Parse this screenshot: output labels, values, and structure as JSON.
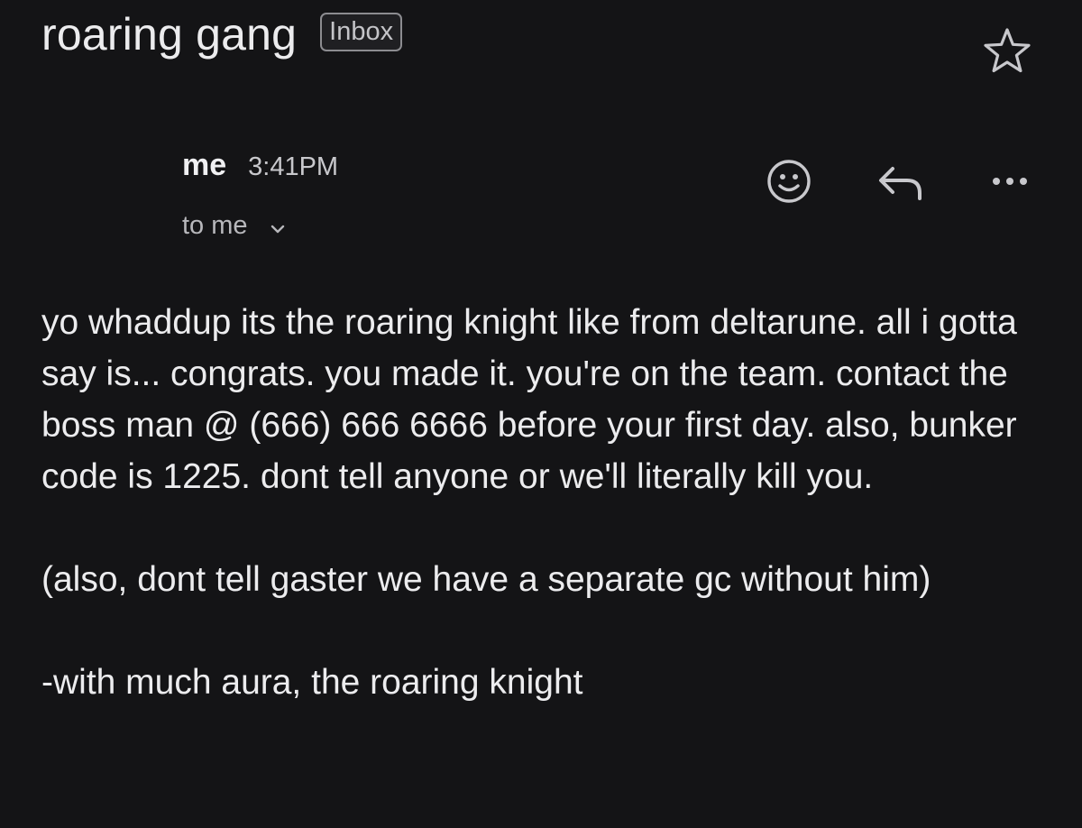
{
  "email": {
    "subject": "roaring gang",
    "label": "Inbox",
    "sender": "me",
    "time": "3:41PM",
    "recipient": "to me",
    "body": {
      "paragraph_1": "yo whaddup its the roaring knight like from deltarune. all i gotta say is... congrats. you made it. you're on the team. contact the boss man @ (666) 666 6666 before your first day. also, bunker code is 1225. dont tell anyone or we'll literally kill you.",
      "paragraph_2": "(also, dont tell gaster we have a separate gc without him)",
      "signature": "-with much aura, the roaring knight"
    }
  },
  "icons": {
    "star": "star-icon",
    "emoji": "emoji-reaction-icon",
    "reply": "reply-icon",
    "more": "more-options-icon",
    "expand": "chevron-down-icon"
  },
  "colors": {
    "background": "#141416",
    "text": "#ececee",
    "muted_text": "#b8b8bc",
    "chip_border": "#8c8c90"
  }
}
